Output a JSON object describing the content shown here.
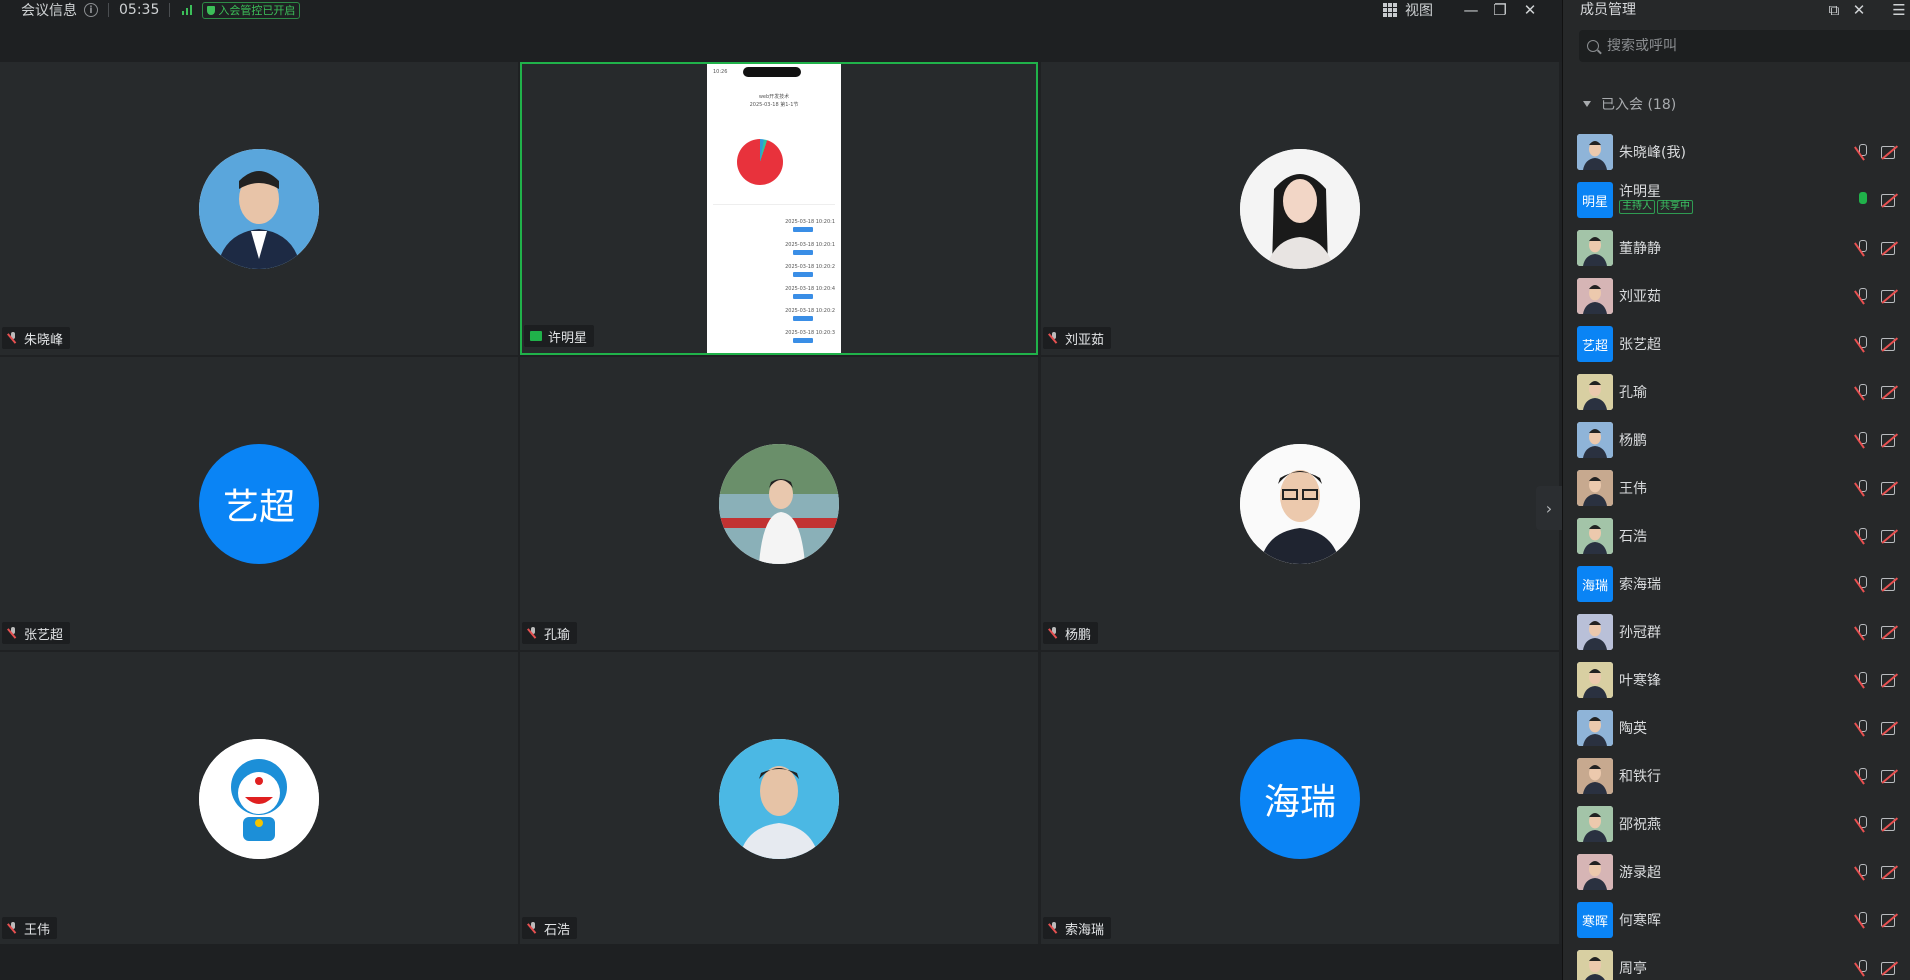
{
  "topbar": {
    "title": "会议信息",
    "info_glyph": "i",
    "timer": "05:35",
    "lock_badge": "入会管控已开启",
    "view_label": "视图",
    "minimize": "—",
    "restore": "❐",
    "close": "✕"
  },
  "tiles": [
    {
      "name": "朱晓峰",
      "avatar_type": "photo"
    },
    {
      "name": "许明星",
      "avatar_type": "screen-share",
      "active": true
    },
    {
      "name": "刘亚茹",
      "avatar_type": "photo"
    },
    {
      "name": "张艺超",
      "avatar_type": "text",
      "avatar_text": "艺超"
    },
    {
      "name": "孔瑜",
      "avatar_type": "photo"
    },
    {
      "name": "杨鹏",
      "avatar_type": "photo"
    },
    {
      "name": "王伟",
      "avatar_type": "photo"
    },
    {
      "name": "石浩",
      "avatar_type": "photo"
    },
    {
      "name": "索海瑞",
      "avatar_type": "text",
      "avatar_text": "海瑞"
    }
  ],
  "next_arrow": "›",
  "panel": {
    "title": "成员管理",
    "search_placeholder": "搜索或呼叫",
    "section_label": "已入会 (18)",
    "popout": "⧉",
    "close": "✕",
    "menu": "☰",
    "members": [
      {
        "name": "朱晓峰(我)",
        "avatar_type": "photo"
      },
      {
        "name": "许明星",
        "avatar_type": "text",
        "avatar_text": "明星",
        "tags": [
          "主持人",
          "共享中"
        ],
        "mic_on": true
      },
      {
        "name": "董静静",
        "avatar_type": "photo"
      },
      {
        "name": "刘亚茹",
        "avatar_type": "photo"
      },
      {
        "name": "张艺超",
        "avatar_type": "text",
        "avatar_text": "艺超"
      },
      {
        "name": "孔瑜",
        "avatar_type": "photo"
      },
      {
        "name": "杨鹏",
        "avatar_type": "photo"
      },
      {
        "name": "王伟",
        "avatar_type": "photo"
      },
      {
        "name": "石浩",
        "avatar_type": "photo"
      },
      {
        "name": "索海瑞",
        "avatar_type": "text",
        "avatar_text": "海瑞"
      },
      {
        "name": "孙冠群",
        "avatar_type": "photo"
      },
      {
        "name": "叶寒锋",
        "avatar_type": "photo"
      },
      {
        "name": "陶英",
        "avatar_type": "photo"
      },
      {
        "name": "和铁行",
        "avatar_type": "photo"
      },
      {
        "name": "邵祝燕",
        "avatar_type": "photo"
      },
      {
        "name": "游录超",
        "avatar_type": "photo"
      },
      {
        "name": "何寒晖",
        "avatar_type": "text",
        "avatar_text": "寒晖"
      },
      {
        "name": "周亭",
        "avatar_type": "photo"
      }
    ]
  },
  "phone": {
    "time": "10:26",
    "title": "web开发技术",
    "date": "2025-03-18 第1-1节",
    "rows": [
      "2025-03-18 10:20:1",
      "2025-03-18 10:20:1",
      "2025-03-18 10:20:2",
      "2025-03-18 10:20:4",
      "2025-03-18 10:20:2",
      "2025-03-18 10:20:3"
    ]
  }
}
